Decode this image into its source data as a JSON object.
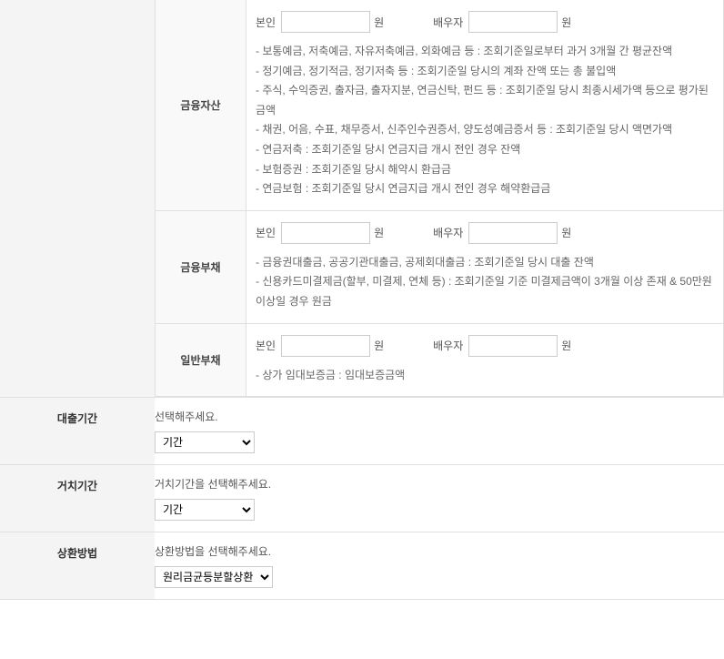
{
  "financial": {
    "assets": {
      "title": "금융자산",
      "self_label": "본인",
      "spouse_label": "배우자",
      "unit": "원",
      "desc": [
        "- 보통예금, 저축예금, 자유저축예금, 외화예금 등 : 조회기준일로부터 과거 3개월 간 평균잔액",
        "- 정기예금, 정기적금, 정기저축 등 : 조회기준일 당시의 계좌 잔액 또는 총 불입액",
        "- 주식, 수익증권, 출자금, 출자지분, 연금신탁, 펀드 등 : 조회기준일 당시 최종시세가액 등으로 평가된 금액",
        "- 채권, 어음, 수표, 채무증서, 신주인수권증서, 양도성예금증서 등 : 조회기준일 당시 액면가액",
        "- 연금저축 : 조회기준일 당시 연금지급 개시 전인 경우 잔액",
        "- 보험증권 : 조회기준일 당시 해약시 환급금",
        "- 연금보험 : 조회기준일 당시 연금지급 개시 전인 경우 해약환급금"
      ]
    },
    "debts": {
      "title": "금융부채",
      "self_label": "본인",
      "spouse_label": "배우자",
      "unit": "원",
      "desc": [
        "- 금융권대출금, 공공기관대출금, 공제회대출금 : 조회기준일 당시 대출 잔액",
        "- 신용카드미결제금(할부, 미결제, 연체 등) : 조회기준일 기준 미결제금액이 3개월 이상 존재 & 50만원 이상일 경우 원금"
      ]
    },
    "general_debts": {
      "title": "일반부채",
      "self_label": "본인",
      "spouse_label": "배우자",
      "unit": "원",
      "desc": [
        "- 상가 임대보증금 : 임대보증금액"
      ]
    }
  },
  "loan_period": {
    "title": "대출기간",
    "hint": "선택해주세요.",
    "select_label": "기간"
  },
  "grace_period": {
    "title": "거치기간",
    "hint": "거치기간을 선택해주세요.",
    "select_label": "기간"
  },
  "repayment": {
    "title": "상환방법",
    "hint": "상환방법을 선택해주세요.",
    "select_label": "원리금균등분할상환"
  }
}
